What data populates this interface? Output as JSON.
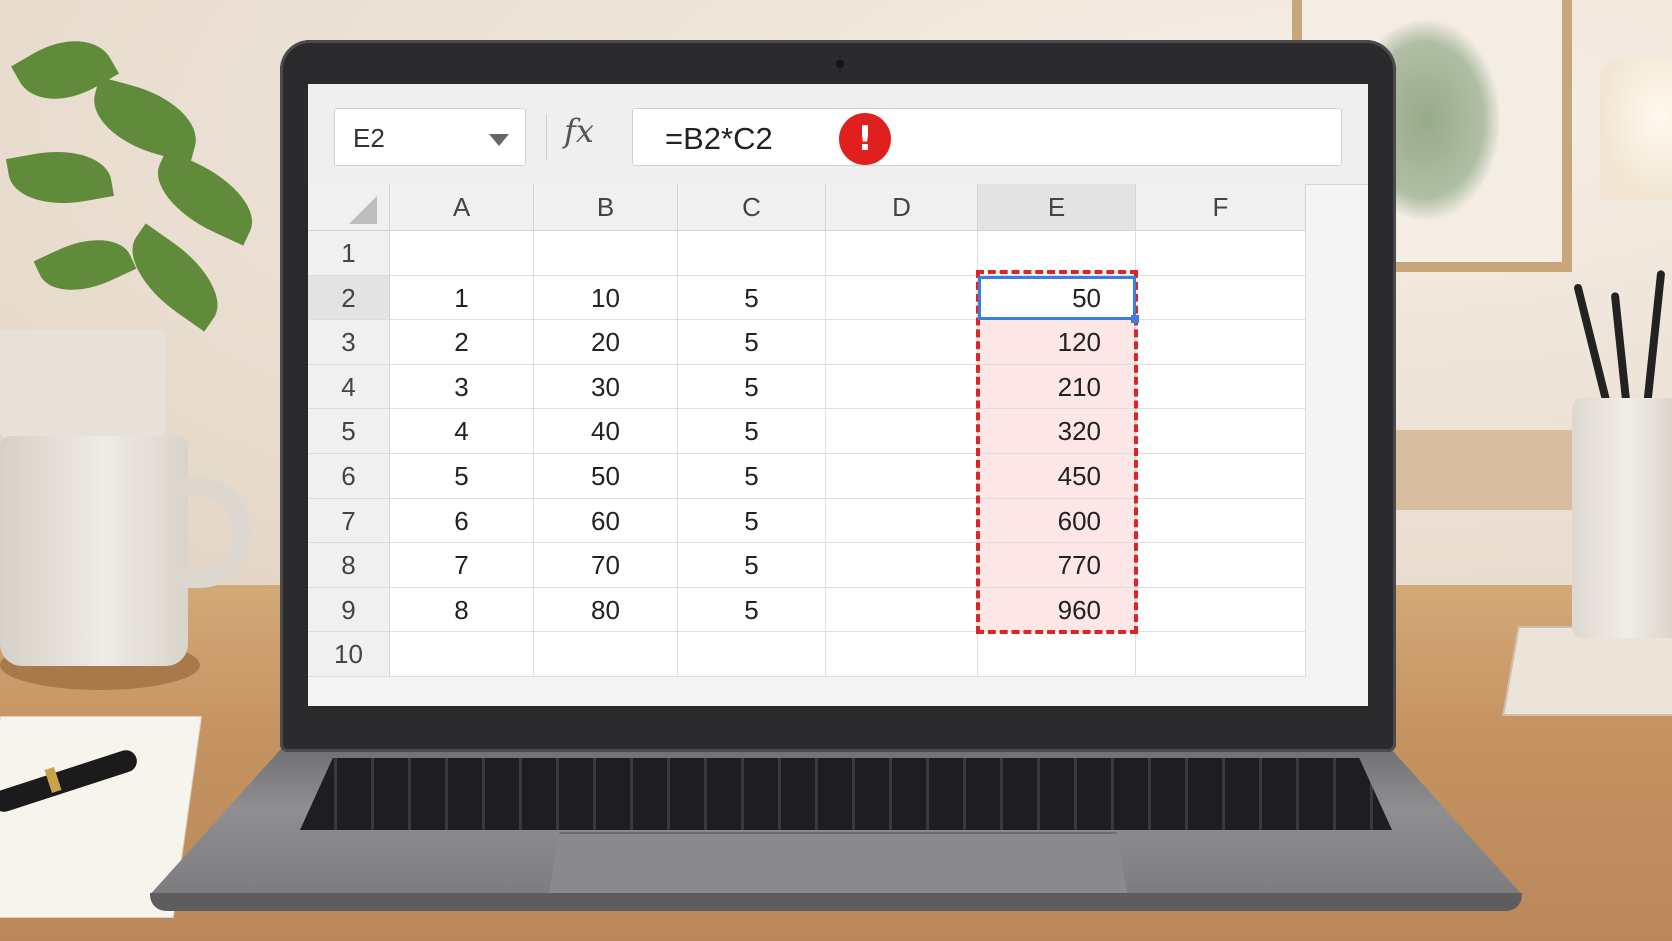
{
  "formula_bar": {
    "name_box": "E2",
    "fx_label": "fx",
    "formula": "=B2*C2",
    "error_icon_glyph": "!",
    "error_icon_color": "#e0201e"
  },
  "columns": [
    "A",
    "B",
    "C",
    "D",
    "E",
    "F"
  ],
  "active_column": "E",
  "rows": [
    {
      "num": "1",
      "cells": [
        "",
        "",
        "",
        "",
        "",
        ""
      ]
    },
    {
      "num": "2",
      "cells": [
        "1",
        "10",
        "5",
        "",
        "50",
        ""
      ]
    },
    {
      "num": "3",
      "cells": [
        "2",
        "20",
        "5",
        "",
        "120",
        ""
      ]
    },
    {
      "num": "4",
      "cells": [
        "3",
        "30",
        "5",
        "",
        "210",
        ""
      ]
    },
    {
      "num": "5",
      "cells": [
        "4",
        "40",
        "5",
        "",
        "320",
        ""
      ]
    },
    {
      "num": "6",
      "cells": [
        "5",
        "50",
        "5",
        "",
        "450",
        ""
      ]
    },
    {
      "num": "7",
      "cells": [
        "6",
        "60",
        "5",
        "",
        "600",
        ""
      ]
    },
    {
      "num": "8",
      "cells": [
        "7",
        "70",
        "5",
        "",
        "770",
        ""
      ]
    },
    {
      "num": "9",
      "cells": [
        "8",
        "80",
        "5",
        "",
        "960",
        ""
      ]
    },
    {
      "num": "10",
      "cells": [
        "",
        "",
        "",
        "",
        "",
        ""
      ]
    }
  ],
  "selected_cell": "E2",
  "flagged_range": "E2:E9",
  "colors": {
    "selection": "#3b7de0",
    "flag_border": "#e02424",
    "flag_fill": "#fde6e6"
  }
}
